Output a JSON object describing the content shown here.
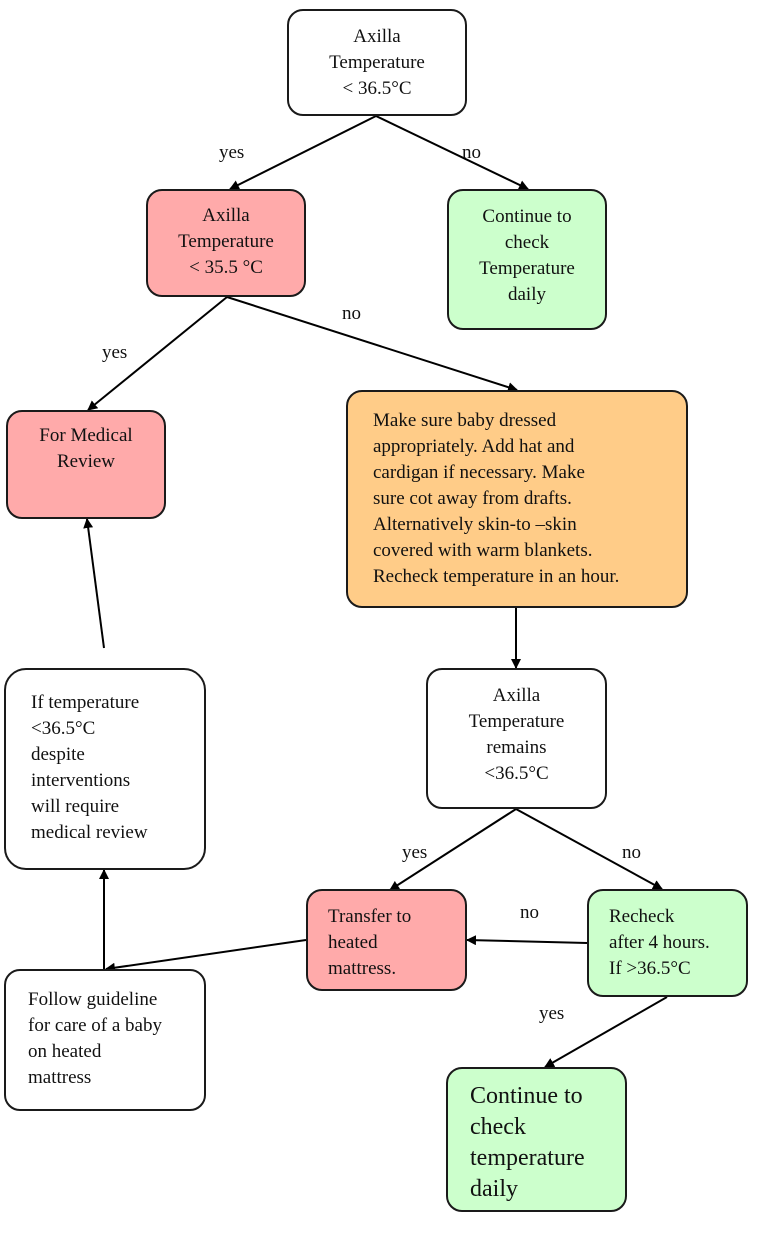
{
  "diagram": {
    "colors": {
      "decision_white": "#ffffff",
      "alert_red": "#ffaaaa",
      "ok_green": "#ccffcc",
      "action_orange": "#ffcc88",
      "stroke": "#1a1a1a"
    },
    "nodes": {
      "q1": "Axilla\nTemperature\n< 36.5°C",
      "continue1": "Continue to\ncheck\nTemperature\ndaily",
      "q2": "Axilla\nTemperature\n< 35.5 °C",
      "medical_review": "For Medical\nReview",
      "interventions": "Make sure baby dressed\nappropriately. Add hat and\ncardigan if necessary.  Make\nsure cot away from drafts.\nAlternatively skin-to –skin\ncovered with warm blankets.\nRecheck temperature in an hour.",
      "q3": "Axilla\nTemperature\nremains\n<36.5°C",
      "despite": "If temperature\n<36.5°C\ndespite\ninterventions\nwill require\nmedical review",
      "transfer": "Transfer to\nheated\nmattress.",
      "recheck": "Recheck\nafter 4 hours.\nIf  >36.5°C",
      "follow": "Follow guideline\nfor care of a baby\non heated\nmattress",
      "continue2": "Continue to\ncheck\ntemperature\ndaily"
    },
    "edge_labels": {
      "q1_yes": "yes",
      "q1_no": "no",
      "q2_yes": "yes",
      "q2_no": "no",
      "q3_yes": "yes",
      "q3_no": "no",
      "recheck_no": "no",
      "recheck_yes": "yes"
    }
  }
}
